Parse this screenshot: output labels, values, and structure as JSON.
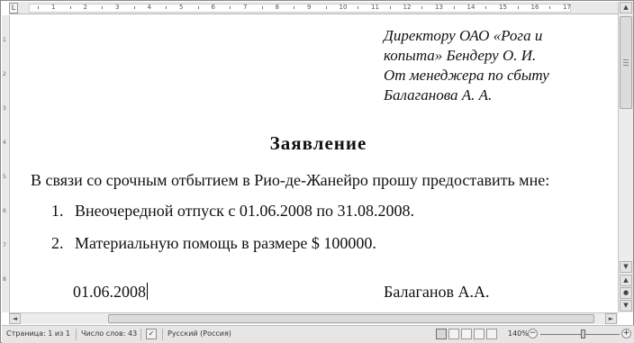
{
  "ruler": {
    "tab_selector": "L",
    "numbers": [
      "1",
      "2",
      "3",
      "4",
      "5",
      "6",
      "7",
      "8",
      "9",
      "10",
      "11",
      "12",
      "13",
      "14",
      "15",
      "16",
      "17"
    ],
    "vertical_numbers": [
      "1",
      "2",
      "3",
      "4",
      "5",
      "6",
      "7",
      "8"
    ]
  },
  "document": {
    "addressee_lines": [
      "Директору ОАО «Рога и",
      "копыта» Бендеру О. И.",
      "От менеджера по сбыту",
      "Балаганова А. А."
    ],
    "title": "Заявление",
    "intro": "В связи со срочным отбытием в Рио-де-Жанейро прошу предоставить мне:",
    "items": [
      {
        "number": "1.",
        "text": "Внеочередной отпуск с 01.06.2008 по 31.08.2008."
      },
      {
        "number": "2.",
        "text": "Материальную помощь в размере $ 100000."
      }
    ],
    "date": "01.06.2008",
    "signer": "Балаганов А.А."
  },
  "status_bar": {
    "page": "Страница: 1 из 1",
    "word_count": "Число слов: 43",
    "language": "Русский (Россия)",
    "zoom": "140%",
    "zoom_level_percent": 140,
    "zoom_minus": "−",
    "zoom_plus": "+"
  },
  "scrollbars": {
    "up": "▲",
    "down": "▼",
    "left": "◄",
    "right": "►",
    "prev_page": "▲",
    "select_browse": "●",
    "next_page": "▼"
  },
  "icons": {
    "spelling": "spelling-check-icon",
    "views": [
      "print-layout-icon",
      "full-screen-reading-icon",
      "web-layout-icon",
      "outline-icon",
      "draft-icon"
    ]
  }
}
